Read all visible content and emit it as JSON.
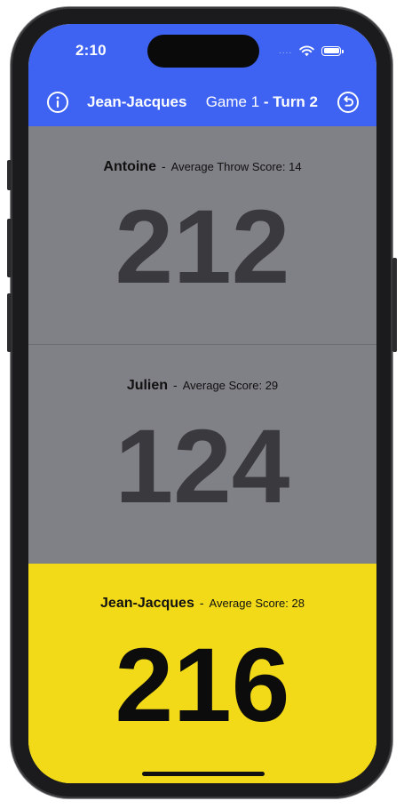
{
  "status_bar": {
    "time": "2:10",
    "signal_dots": "....",
    "wifi_icon": "wifi-icon",
    "battery_icon": "battery-icon"
  },
  "nav": {
    "info_icon": "info-circle-icon",
    "current_player": "Jean-Jacques",
    "game_label": "Game 1",
    "turn_label": "- Turn 2",
    "undo_icon": "undo-icon"
  },
  "players": [
    {
      "name": "Antoine",
      "separator": "-",
      "average_label": "Average Throw Score: 14",
      "score": "212",
      "active": false
    },
    {
      "name": "Julien",
      "separator": "-",
      "average_label": "Average Score: 29",
      "score": "124",
      "active": false
    },
    {
      "name": "Jean-Jacques",
      "separator": "-",
      "average_label": "Average Score: 28",
      "score": "216",
      "active": true
    }
  ],
  "colors": {
    "nav_blue": "#3e63f2",
    "inactive_panel": "#808087",
    "active_panel": "#f2da19",
    "inactive_score": "#3a3a3e",
    "active_score": "#0c0c0c"
  }
}
